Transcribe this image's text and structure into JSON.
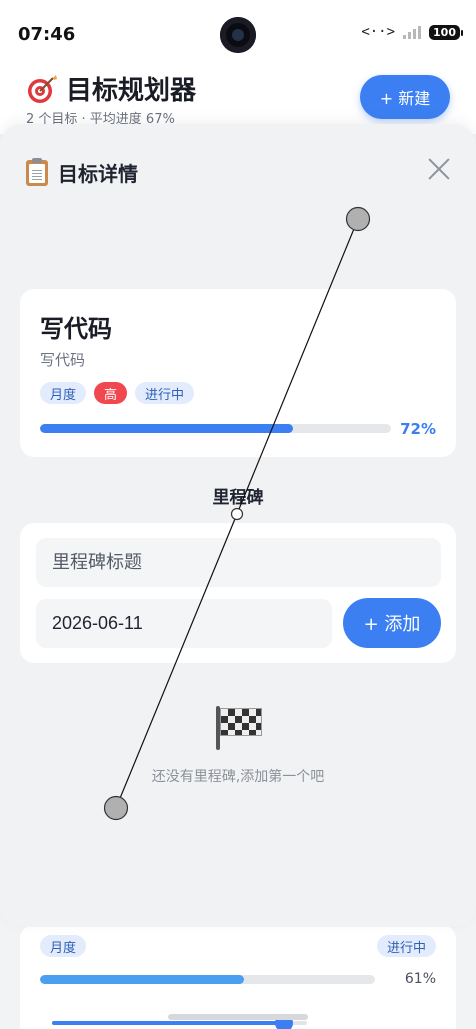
{
  "status_bar": {
    "time": "07:46",
    "net_label": "<··>",
    "signal_label": "x",
    "battery": "100"
  },
  "header": {
    "icon": "target-dart-icon",
    "title": "目标规划器",
    "subtitle": "2 个目标 · 平均进度 67%",
    "new_button_label": "+ 新建"
  },
  "modal": {
    "icon": "clipboard-icon",
    "title": "目标详情",
    "close_icon": "close-icon"
  },
  "goal": {
    "title": "写代码",
    "description": "写代码",
    "tags": [
      "月度",
      "高",
      "进行中"
    ],
    "progress": 72,
    "progress_label": "72%",
    "colors": {
      "accent": "#3b7ff2",
      "priority_high": "#f0484e",
      "tag_bg": "#e3ecfc"
    }
  },
  "milestones": {
    "section_title": "里程碑",
    "title_placeholder": "里程碑标题",
    "date_value": "2026-06-11",
    "add_button_label": "+ 添加",
    "empty_icon": "checkered-flag-icon",
    "empty_text": "还没有里程碑,添加第一个吧"
  },
  "background_card": {
    "tag_left": "月度",
    "tag_right": "进行中",
    "progress": 61,
    "progress_label": "61%",
    "slider_value": 0.91
  }
}
